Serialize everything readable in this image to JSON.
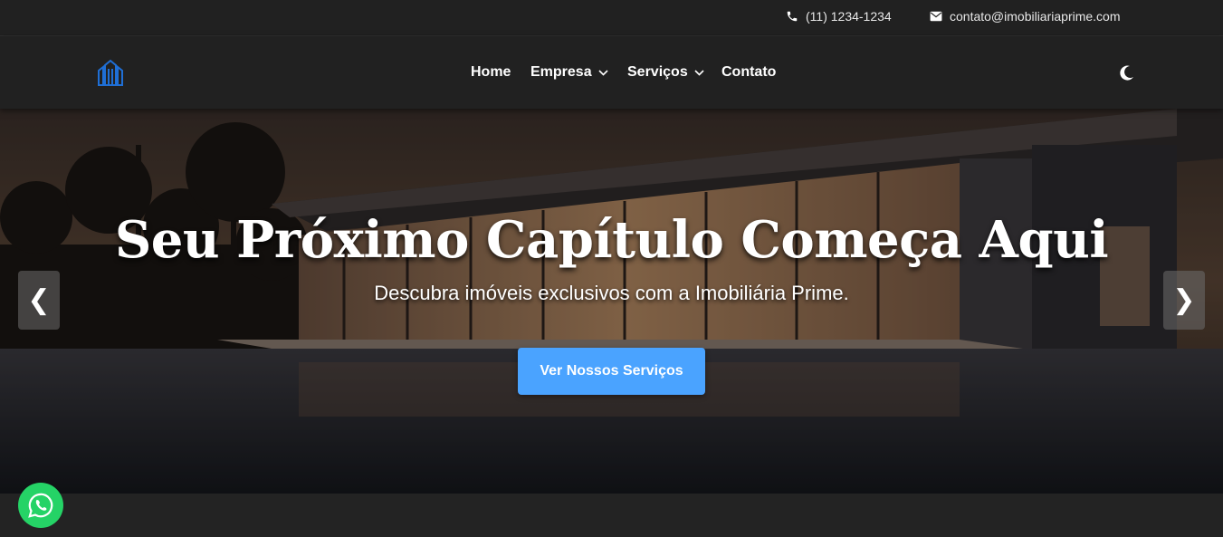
{
  "topbar": {
    "phone": "(11) 1234-1234",
    "email": "contato@imobiliariaprime.com"
  },
  "navbar": {
    "logo_icon": "building-logo-icon",
    "items": [
      {
        "label": "Home",
        "dropdown": false
      },
      {
        "label": "Empresa",
        "dropdown": true
      },
      {
        "label": "Serviços",
        "dropdown": true
      },
      {
        "label": "Contato",
        "dropdown": false
      }
    ],
    "theme_icon": "moon-icon"
  },
  "hero": {
    "title": "Seu Próximo Capítulo Começa Aqui",
    "subtitle": "Descubra imóveis exclusivos com a Imobiliária Prime.",
    "button_label": "Ver Nossos Serviços",
    "prev_arrow": "❮",
    "next_arrow": "❯"
  },
  "colors": {
    "accent": "#4aa3ff",
    "logo": "#1f6fd6",
    "whatsapp": "#25d366",
    "background": "#232323"
  }
}
